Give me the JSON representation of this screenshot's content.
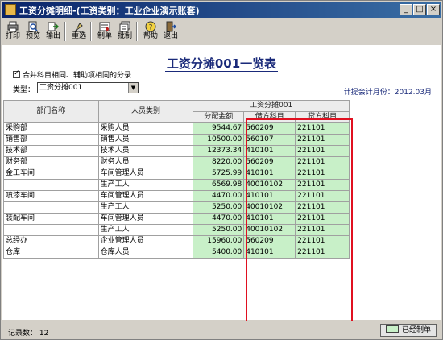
{
  "window": {
    "title": "工资分摊明细-(工资类别：工业企业演示账套)",
    "controls": [
      "_",
      "□",
      "×"
    ]
  },
  "toolbar": {
    "items": [
      {
        "label": "打印",
        "icon": "printer-icon"
      },
      {
        "label": "预览",
        "icon": "preview-icon"
      },
      {
        "label": "输出",
        "icon": "export-icon"
      },
      {
        "label": "重选",
        "icon": "reselect-icon"
      },
      {
        "label": "制单",
        "icon": "voucher-icon"
      },
      {
        "label": "批制",
        "icon": "batch-voucher-icon"
      },
      {
        "label": "帮助",
        "icon": "help-icon"
      },
      {
        "label": "退出",
        "icon": "exit-icon"
      }
    ]
  },
  "report": {
    "title": "工资分摊001一览表",
    "merge_option": "合并科目相同、辅助项相同的分录",
    "type_label": "类型：",
    "type_value": "工资分摊001",
    "period_label": "计提会计月份：",
    "period_value": "2012.03月"
  },
  "table": {
    "headers": {
      "dept": "部门名称",
      "category": "人员类别",
      "group": "工资分摊001",
      "amount": "分配金额",
      "debit": "借方科目",
      "credit": "贷方科目"
    },
    "rows": [
      {
        "dept": "采购部",
        "category": "采购人员",
        "amount": "9544.67",
        "debit": "560209",
        "credit": "221101"
      },
      {
        "dept": "销售部",
        "category": "销售人员",
        "amount": "10500.00",
        "debit": "560107",
        "credit": "221101"
      },
      {
        "dept": "技术部",
        "category": "技术人员",
        "amount": "12373.34",
        "debit": "410101",
        "credit": "221101"
      },
      {
        "dept": "财务部",
        "category": "财务人员",
        "amount": "8220.00",
        "debit": "560209",
        "credit": "221101"
      },
      {
        "dept": "金工车间",
        "category": "车间管理人员",
        "amount": "5725.99",
        "debit": "410101",
        "credit": "221101"
      },
      {
        "dept": "",
        "category": "生产工人",
        "amount": "6569.98",
        "debit": "40010102",
        "credit": "221101"
      },
      {
        "dept": "喷漆车间",
        "category": "车间管理人员",
        "amount": "4470.00",
        "debit": "410101",
        "credit": "221101"
      },
      {
        "dept": "",
        "category": "生产工人",
        "amount": "5250.00",
        "debit": "40010102",
        "credit": "221101"
      },
      {
        "dept": "装配车间",
        "category": "车间管理人员",
        "amount": "4470.00",
        "debit": "410101",
        "credit": "221101"
      },
      {
        "dept": "",
        "category": "生产工人",
        "amount": "5250.00",
        "debit": "40010102",
        "credit": "221101"
      },
      {
        "dept": "总经办",
        "category": "企业管理人员",
        "amount": "15960.00",
        "debit": "560209",
        "credit": "221101"
      },
      {
        "dept": "仓库",
        "category": "仓库人员",
        "amount": "5400.00",
        "debit": "410101",
        "credit": "221101"
      }
    ]
  },
  "status": {
    "record_label": "记录数：",
    "record_count": "12",
    "voucher_status": "已经制单"
  },
  "colors": {
    "title_bar_start": "#0a246a",
    "title_bar_end": "#3a6ea5",
    "cell_fill": "#c8f0c8",
    "highlight_border": "#e01020",
    "report_title": "#1a2a7a"
  }
}
